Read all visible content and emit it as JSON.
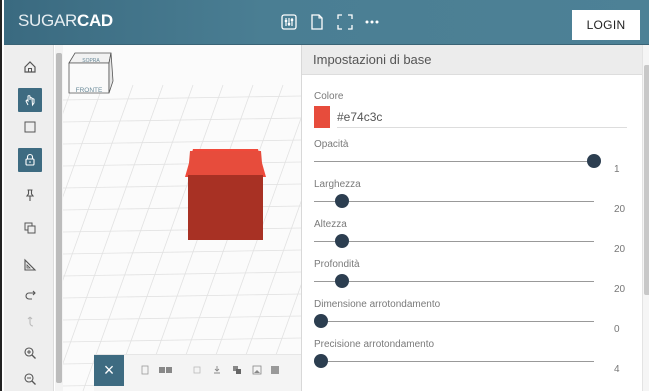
{
  "app": {
    "logo_light": "SUGAR",
    "logo_bold": "CAD",
    "login_label": "LOGIN"
  },
  "header_icons": [
    "equalizer-icon",
    "document-icon",
    "fullscreen-icon",
    "more-icon"
  ],
  "toolbar": {
    "items": [
      "home-icon",
      "hand-icon",
      "square-select-icon",
      "lock-icon",
      "pin-icon",
      "copy-icon",
      "ruler-icon",
      "redo-icon",
      "undo-icon",
      "zoom-in-icon",
      "zoom-out-icon"
    ],
    "active": [
      "hand-icon",
      "lock-icon"
    ]
  },
  "viewcube": {
    "top": "SOPRA",
    "front": "FRONTE"
  },
  "object": {
    "color": "#e74c3c"
  },
  "panel": {
    "title": "Impostazioni di base",
    "color_label": "Colore",
    "color_value": "#e74c3c",
    "sliders": [
      {
        "label": "Opacità",
        "value": "1",
        "fraction": 1.0
      },
      {
        "label": "Larghezza",
        "value": "20",
        "fraction": 0.1
      },
      {
        "label": "Altezza",
        "value": "20",
        "fraction": 0.1
      },
      {
        "label": "Profondità",
        "value": "20",
        "fraction": 0.1
      },
      {
        "label": "Dimensione arrotondamento",
        "value": "0",
        "fraction": 0.0
      },
      {
        "label": "Precisione arrotondamento",
        "value": "4",
        "fraction": 0.0
      }
    ]
  },
  "bottombar": {
    "close_label": "×"
  }
}
